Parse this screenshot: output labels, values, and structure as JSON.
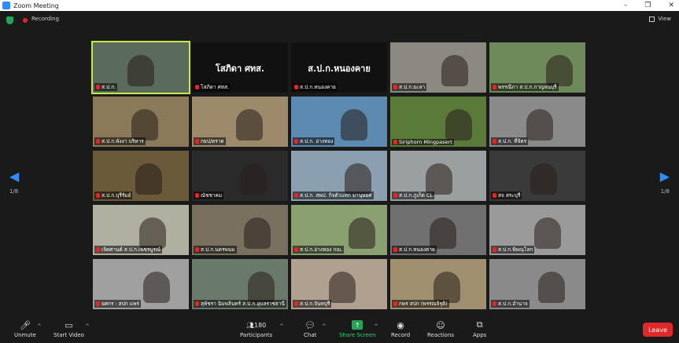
{
  "window": {
    "title": "Zoom Meeting",
    "controls": [
      "–",
      "❐",
      "✕"
    ]
  },
  "status": {
    "recording_label": "Recording",
    "view_label": "View"
  },
  "pager": {
    "left": "1/8",
    "right": "1/8"
  },
  "tiles": [
    {
      "name": "ส.ป.ก.",
      "bg": "#5a6a5c",
      "active": true,
      "big": ""
    },
    {
      "name": "โสภิดา ศทส.",
      "bg": "#111111",
      "big": "โสภิดา ศทส."
    },
    {
      "name": "ส.ป.ก.หนองคาย",
      "bg": "#111111",
      "big": "ส.ป.ก.หนองคาย"
    },
    {
      "name": "ส.ป.ก.ยะลา",
      "bg": "#8c8a80",
      "big": ""
    },
    {
      "name": "พรรณีภา ส.ป.ก.กาญจนบุรี",
      "bg": "#6f8a5a",
      "big": ""
    },
    {
      "name": "ส.ป.ก.พังงา บริหาร",
      "bg": "#8a7a5a",
      "big": ""
    },
    {
      "name": "กยป/ตราด",
      "bg": "#9c8a6a",
      "big": ""
    },
    {
      "name": "ส.ป.ก. อ่างทอง",
      "bg": "#5c8ab0",
      "big": ""
    },
    {
      "name": "Siriphorn Mingpasert",
      "bg": "#5a7a3a",
      "big": ""
    },
    {
      "name": "ส.ป.ก. ที่จิตร",
      "bg": "#8a8a8a",
      "big": ""
    },
    {
      "name": "ส.ป.ก.บุรีรัมย์",
      "bg": "#6a5a3a",
      "big": ""
    },
    {
      "name": "ณัชชาคม",
      "bg": "#2a2a2a",
      "big": ""
    },
    {
      "name": "ส.ป.ก. สพป. กิจตัวแทก มานุษยศ",
      "bg": "#8aa0b0",
      "big": ""
    },
    {
      "name": "ส.ป.ก.ภูเก็ต CL",
      "bg": "#9aa0a0",
      "big": ""
    },
    {
      "name": "สจ สระบุรี",
      "bg": "#3a3a3a",
      "big": ""
    },
    {
      "name": "เจิดศานต์ ส.ป.ก.เพชรบูรณ์",
      "bg": "#b0b0a0",
      "big": ""
    },
    {
      "name": "ส.ป.ก.นครพนม",
      "bg": "#7a7060",
      "big": ""
    },
    {
      "name": "ส.ป.ก.อ่างทอง กณ.",
      "bg": "#8aa070",
      "big": ""
    },
    {
      "name": "ส.ป.ก.หนองคาย",
      "bg": "#707070",
      "big": ""
    },
    {
      "name": "ส.ป.ก.พิษณุโลก",
      "bg": "#9a9a9a",
      "big": ""
    },
    {
      "name": "ยศกร : สปก แพร่",
      "bg": "#a0a0a0",
      "big": ""
    },
    {
      "name": "สุพัชรา ฉิมพลินทร์ ส.ป.ก.อุบลราชธานี",
      "bg": "#6a7a6a",
      "big": ""
    },
    {
      "name": "ส.ป.ก.จันทบุรี",
      "bg": "#b0a090",
      "big": ""
    },
    {
      "name": "กพร สปก (พรรณจิรุติ)",
      "bg": "#a09070",
      "big": ""
    },
    {
      "name": "ส.ป.ก.อำนาจ",
      "bg": "#8a8a8a",
      "big": ""
    }
  ],
  "toolbar": {
    "unmute": "Unmute",
    "start_video": "Start Video",
    "participants": "Participants",
    "participant_count": "180",
    "chat": "Chat",
    "share": "Share Screen",
    "record": "Record",
    "reactions": "Reactions",
    "apps": "Apps",
    "leave": "Leave"
  },
  "colors": {
    "accent": "#2d8cff",
    "leave": "#e02828",
    "share": "#23a559",
    "active_border": "#c6e84a"
  }
}
